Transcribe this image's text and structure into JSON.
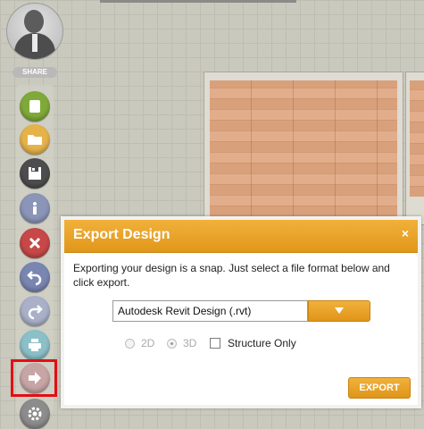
{
  "toolbar": {
    "share_label": "SHARE",
    "buttons": [
      {
        "name": "new-design-button",
        "icon": "new-page-icon",
        "color": "#7faa3a"
      },
      {
        "name": "open-design-button",
        "icon": "folder-icon",
        "color": "#e6b34a"
      },
      {
        "name": "save-design-button",
        "icon": "floppy-disk-icon",
        "color": "#4d4d4d"
      },
      {
        "name": "info-button",
        "icon": "info-icon",
        "color": "#8b95b8"
      },
      {
        "name": "delete-button",
        "icon": "close-icon",
        "color": "#c74848"
      },
      {
        "name": "undo-button",
        "icon": "undo-icon",
        "color": "#7a86b2"
      },
      {
        "name": "redo-button",
        "icon": "redo-icon",
        "color": "#a9b0c8"
      },
      {
        "name": "print-button",
        "icon": "printer-icon",
        "color": "#8cc0c9"
      },
      {
        "name": "export-toolbar-button",
        "icon": "arrow-right-icon",
        "color": "#c8a5a5"
      },
      {
        "name": "settings-button",
        "icon": "gear-icon",
        "color": "#8c8c8c"
      }
    ]
  },
  "dialog": {
    "title": "Export Design",
    "close_glyph": "×",
    "description": "Exporting your design is a snap. Just select a file format below and click export.",
    "format_value": "Autodesk Revit Design (.rvt)",
    "options": [
      {
        "label": "2D",
        "selected": false,
        "enabled": false
      },
      {
        "label": "3D",
        "selected": true,
        "enabled": false
      }
    ],
    "structure_only_label": "Structure Only",
    "structure_only_checked": false,
    "export_label": "EXPORT"
  },
  "colors": {
    "accent": "#e8a32a",
    "highlight": "#e30e14"
  }
}
